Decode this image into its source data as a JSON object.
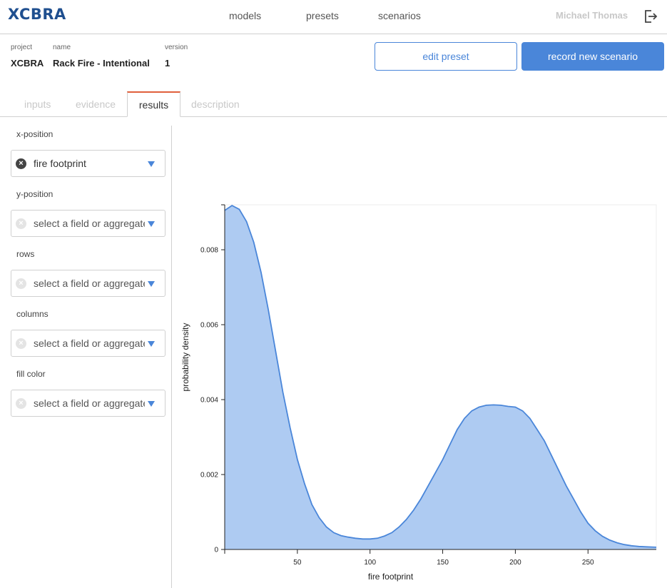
{
  "app": {
    "logo": "XCBRA"
  },
  "nav": {
    "items": [
      "models",
      "presets",
      "scenarios"
    ]
  },
  "user": {
    "name": "Michael Thomas",
    "logout_icon": "logout-icon"
  },
  "project": {
    "project_label": "project",
    "project_value": "XCBRA",
    "name_label": "name",
    "name_value": "Rack Fire - Intentional",
    "version_label": "version",
    "version_value": "1"
  },
  "actions": {
    "edit_label": "edit preset",
    "record_label": "record new scenario"
  },
  "tabs": {
    "items": [
      "inputs",
      "evidence",
      "results",
      "description"
    ],
    "active": "results"
  },
  "encodings": [
    {
      "label": "x-position",
      "value": "fire footprint",
      "placeholder": ""
    },
    {
      "label": "y-position",
      "value": "",
      "placeholder": "select a field or aggregate"
    },
    {
      "label": "rows",
      "value": "",
      "placeholder": "select a field or aggregate"
    },
    {
      "label": "columns",
      "value": "",
      "placeholder": "select a field or aggregate"
    },
    {
      "label": "fill color",
      "value": "",
      "placeholder": "select a field or aggregate"
    }
  ],
  "colors": {
    "accent": "#4a86d9",
    "area_fill": "#aecbf2",
    "area_line": "#4a86d9",
    "active_tab": "#e0603c"
  },
  "chart_data": {
    "type": "area",
    "xlabel": "fire footprint",
    "ylabel": "probability density",
    "xlim": [
      0,
      297
    ],
    "ylim": [
      0,
      0.0092
    ],
    "xticks": [
      50,
      100,
      150,
      200,
      250
    ],
    "yticks": [
      0,
      0.002,
      0.004,
      0.006,
      0.008
    ],
    "ytick_labels": [
      "0",
      "0.002",
      "0.004",
      "0.006",
      "0.008"
    ],
    "x": [
      0,
      5,
      10,
      15,
      20,
      25,
      30,
      35,
      40,
      45,
      50,
      55,
      60,
      65,
      70,
      75,
      80,
      85,
      90,
      95,
      100,
      105,
      110,
      115,
      120,
      125,
      130,
      135,
      140,
      145,
      150,
      155,
      160,
      165,
      170,
      175,
      180,
      185,
      190,
      195,
      200,
      205,
      210,
      215,
      220,
      225,
      230,
      235,
      240,
      245,
      250,
      255,
      260,
      265,
      270,
      275,
      280,
      285,
      290,
      297
    ],
    "y": [
      0.00905,
      0.00918,
      0.00908,
      0.00875,
      0.0082,
      0.0074,
      0.0064,
      0.0053,
      0.0042,
      0.00325,
      0.0024,
      0.00175,
      0.0012,
      0.00085,
      0.0006,
      0.00045,
      0.00037,
      0.00033,
      0.0003,
      0.00028,
      0.00028,
      0.0003,
      0.00036,
      0.00045,
      0.0006,
      0.0008,
      0.00105,
      0.00135,
      0.0017,
      0.00205,
      0.0024,
      0.0028,
      0.0032,
      0.0035,
      0.0037,
      0.0038,
      0.00385,
      0.00386,
      0.00385,
      0.00382,
      0.0038,
      0.0037,
      0.0035,
      0.0032,
      0.0029,
      0.0025,
      0.0021,
      0.0017,
      0.00135,
      0.001,
      0.0007,
      0.0005,
      0.00035,
      0.00025,
      0.00018,
      0.00013,
      0.0001,
      8e-05,
      7e-05,
      6e-05
    ]
  }
}
